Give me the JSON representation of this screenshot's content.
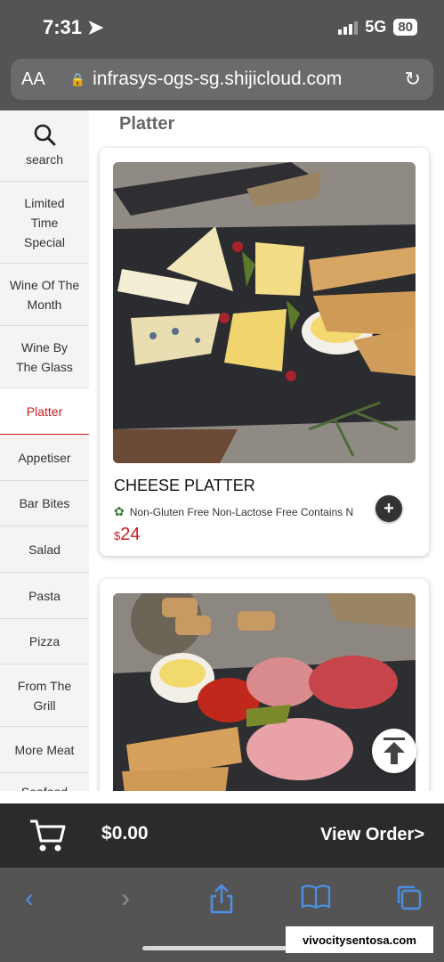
{
  "status_bar": {
    "time": "7:31",
    "network": "5G",
    "battery": "80"
  },
  "browser": {
    "text_size_label": "AA",
    "url": "infrasys-ogs-sg.shijicloud.com"
  },
  "sidebar": {
    "search_label": "search",
    "items": [
      {
        "label": "Limited Time Special"
      },
      {
        "label": "Wine Of The Month"
      },
      {
        "label": "Wine By The Glass"
      },
      {
        "label": "Platter",
        "active": true
      },
      {
        "label": "Appetiser"
      },
      {
        "label": "Bar Bites"
      },
      {
        "label": "Salad"
      },
      {
        "label": "Pasta"
      },
      {
        "label": "Pizza"
      },
      {
        "label": "From The Grill"
      },
      {
        "label": "More Meat"
      },
      {
        "label": "Seafood"
      }
    ]
  },
  "menu": {
    "section_title": "Platter",
    "items": [
      {
        "name": "CHEESE PLATTER",
        "description": "Non-Gluten Free Non-Lactose Free Contains N",
        "currency": "$",
        "price": "24"
      }
    ]
  },
  "cart": {
    "currency": "$",
    "total": "0.00",
    "view_order_label": "View Order>"
  },
  "watermark": "vivocitysentosa.com",
  "colors": {
    "accent": "#c61f1f",
    "chrome": "#545454",
    "cart_bar": "#2b2b2b",
    "safari_blue": "#4a90e2"
  },
  "icons": [
    "location-arrow-icon",
    "signal-icon",
    "text-size-icon",
    "lock-icon",
    "reload-icon",
    "search-icon",
    "vegetarian-icon",
    "add-icon",
    "scroll-top-icon",
    "cart-icon",
    "back-icon",
    "forward-icon",
    "share-icon",
    "bookmarks-icon",
    "tabs-icon"
  ]
}
